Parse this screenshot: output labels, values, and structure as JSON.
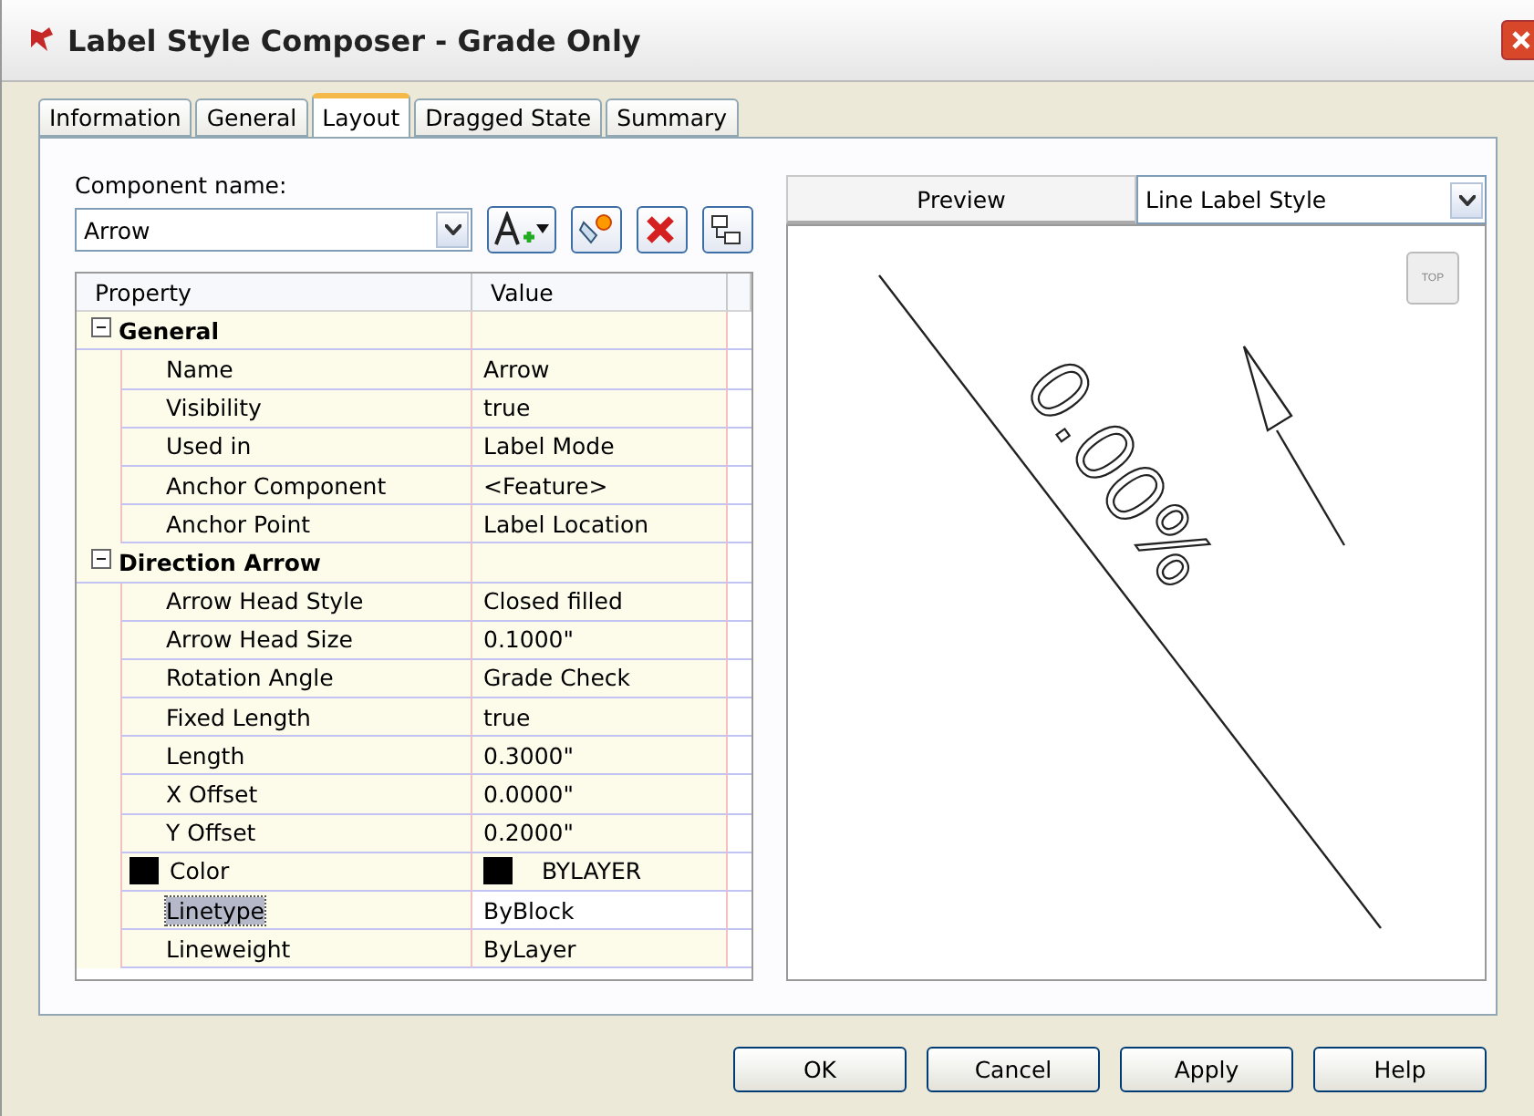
{
  "window": {
    "title": "Label Style Composer - Grade Only"
  },
  "tabs": [
    {
      "label": "Information",
      "selected": false
    },
    {
      "label": "General",
      "selected": false
    },
    {
      "label": "Layout",
      "selected": true
    },
    {
      "label": "Dragged State",
      "selected": false
    },
    {
      "label": "Summary",
      "selected": false
    }
  ],
  "component": {
    "label": "Component name:",
    "value": "Arrow"
  },
  "grid": {
    "columns": [
      "Property",
      "Value"
    ],
    "groups": [
      {
        "name": "General",
        "expanded": true,
        "rows": [
          {
            "property": "Name",
            "value": "Arrow",
            "selected": false
          },
          {
            "property": "Visibility",
            "value": "true",
            "selected": false
          },
          {
            "property": "Used in",
            "value": "Label Mode",
            "selected": false
          },
          {
            "property": "Anchor Component",
            "value": "<Feature>",
            "selected": false
          },
          {
            "property": "Anchor Point",
            "value": "Label Location",
            "selected": false
          }
        ]
      },
      {
        "name": "Direction Arrow",
        "expanded": true,
        "rows": [
          {
            "property": "Arrow Head Style",
            "value": "Closed filled",
            "selected": false
          },
          {
            "property": "Arrow Head Size",
            "value": "0.1000\"",
            "selected": false
          },
          {
            "property": "Rotation Angle",
            "value": "Grade Check",
            "selected": false
          },
          {
            "property": "Fixed Length",
            "value": "true",
            "selected": false
          },
          {
            "property": "Length",
            "value": "0.3000\"",
            "selected": false
          },
          {
            "property": "X Offset",
            "value": "0.0000\"",
            "selected": false
          },
          {
            "property": "Y Offset",
            "value": "0.2000\"",
            "selected": false
          },
          {
            "property": "Color",
            "value": "BYLAYER",
            "selected": false,
            "color": "#000000"
          },
          {
            "property": "Linetype",
            "value": "ByBlock",
            "selected": true
          },
          {
            "property": "Lineweight",
            "value": "ByLayer",
            "selected": false
          }
        ]
      }
    ]
  },
  "preview": {
    "title": "Preview",
    "style": "Line Label Style",
    "view_button": "TOP",
    "label_text": "0.00%"
  },
  "buttons": [
    "OK",
    "Cancel",
    "Apply",
    "Help"
  ]
}
